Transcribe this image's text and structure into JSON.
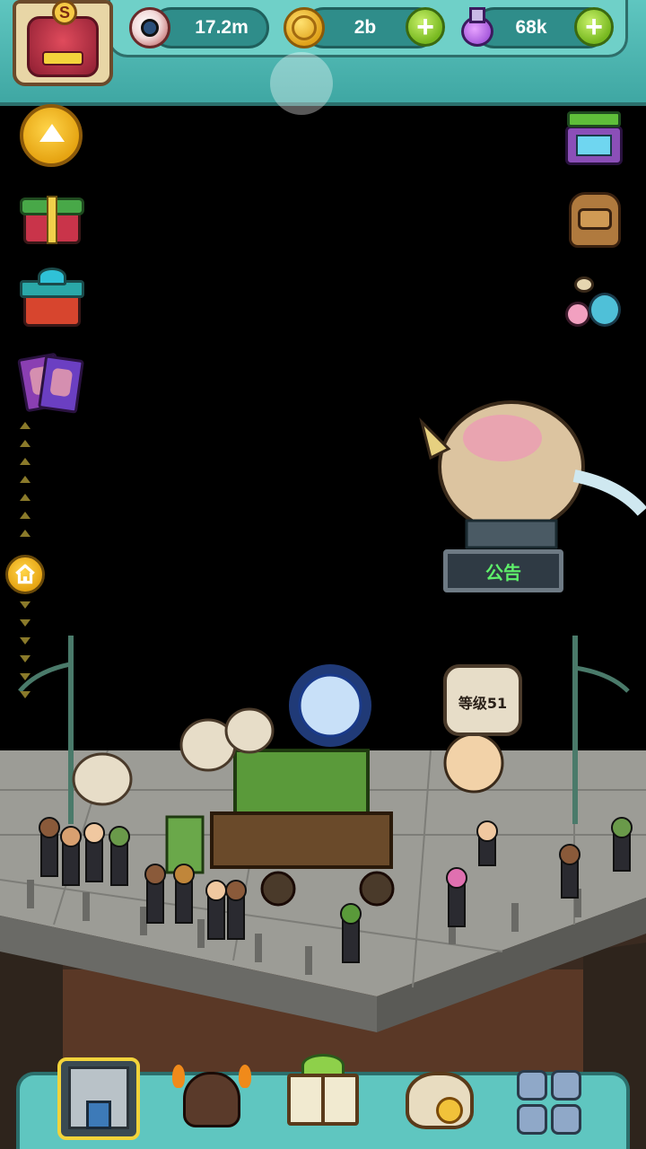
{
  "resources": {
    "eyes": "17.2m",
    "coins": "2b",
    "potions": "68k"
  },
  "avatar": {
    "badge": "S"
  },
  "plus_symbol": "+",
  "scene": {
    "airship_sign": "公告",
    "level_bubble": "等级51"
  },
  "icons": {
    "eye": "eyeball-icon",
    "coin": "coin-icon",
    "potion": "potion-icon",
    "up": "up-arrow-icon",
    "home": "home-icon"
  },
  "colors": {
    "bar": "#5fc6c0",
    "plus": "#77b820",
    "accent_yellow": "#f2d33a",
    "sign_text": "#5ef06a"
  }
}
